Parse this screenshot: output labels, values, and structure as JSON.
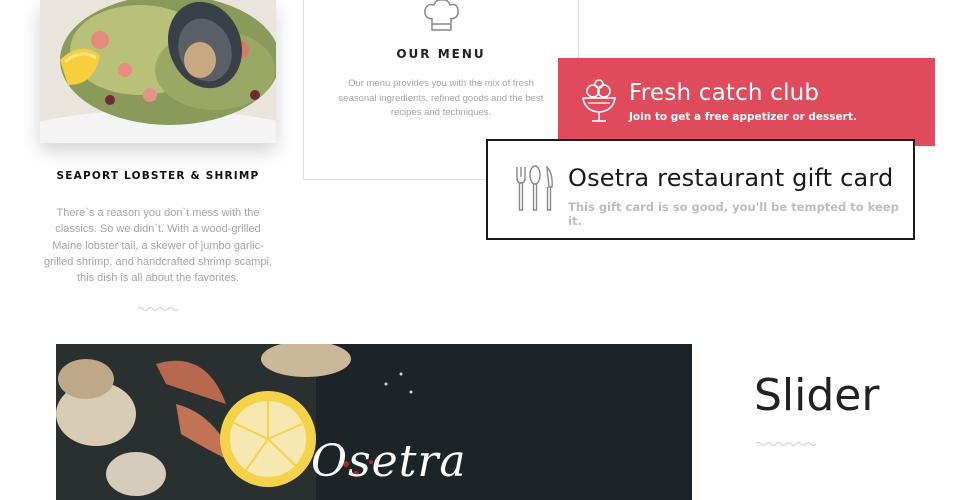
{
  "dish": {
    "title": "SEAPORT LOBSTER & SHRIMP",
    "description": "There`s a reason you don`t mess with the classics. So we didn`t. With a wood-grilled Maine lobster tail, a skewer of jumbo garlic-grilled shrimp, and handcrafted shrimp scampi, this dish is all about the favorites."
  },
  "menu": {
    "icon": "chef-hat-icon",
    "title": "OUR MENU",
    "description": "Our menu provides you with the mix of fresh seasonal ingredients, refined goods and the best recipes and techniques."
  },
  "club": {
    "icon": "ice-cream-cup-icon",
    "title": "Fresh catch club",
    "subtitle": "Join to get a free appetizer or dessert.",
    "color": "#df4b5d"
  },
  "gift": {
    "icon": "cutlery-icon",
    "title": "Osetra restaurant gift card",
    "subtitle": "This gift card is so good, you'll be tempted to keep it."
  },
  "slider": {
    "heading": "Slider",
    "brand_script": "Osetra"
  }
}
